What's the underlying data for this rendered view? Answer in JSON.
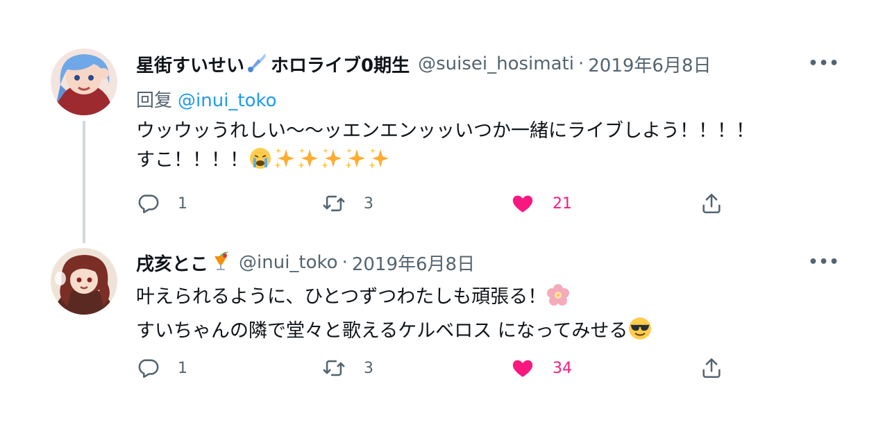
{
  "tweets": [
    {
      "display_name": "星街すいせい",
      "badge_icon": "comet-emoji",
      "name_suffix": "ホロライブ0期生",
      "handle": "@suisei_hosimati",
      "separator": "·",
      "date": "2019年6月8日",
      "reply_label": "回复",
      "reply_to": "@inui_toko",
      "text_line1": "ウッウッうれしい〜〜ッエンエンッッいつか一緒にライブしよう！！！！",
      "text_line2": "すこ！！！！",
      "text_emojis": [
        "loudly-crying-emoji",
        "sparkles-emoji",
        "sparkles-emoji",
        "sparkles-emoji",
        "sparkles-emoji",
        "sparkles-emoji"
      ],
      "replies": "1",
      "retweets": "3",
      "likes": "21",
      "liked": true
    },
    {
      "display_name": "戌亥とこ",
      "badge_icon": "tropical-drink-emoji",
      "handle": "@inui_toko",
      "separator": "·",
      "date": "2019年6月8日",
      "text_line1": "叶えられるように、ひとつずつわたしも頑張る！",
      "text_line1_emoji": "cherry-blossom-emoji",
      "text_line2": "すいちゃんの隣で堂々と歌えるケルベロス になってみせる",
      "text_line2_emoji": "sunglasses-emoji",
      "replies": "1",
      "retweets": "3",
      "likes": "34",
      "liked": true
    }
  ],
  "colors": {
    "text": "#0f1419",
    "secondary": "#536471",
    "link": "#1d9bf0",
    "like": "#f91880",
    "thread_line": "#cfd9de"
  }
}
